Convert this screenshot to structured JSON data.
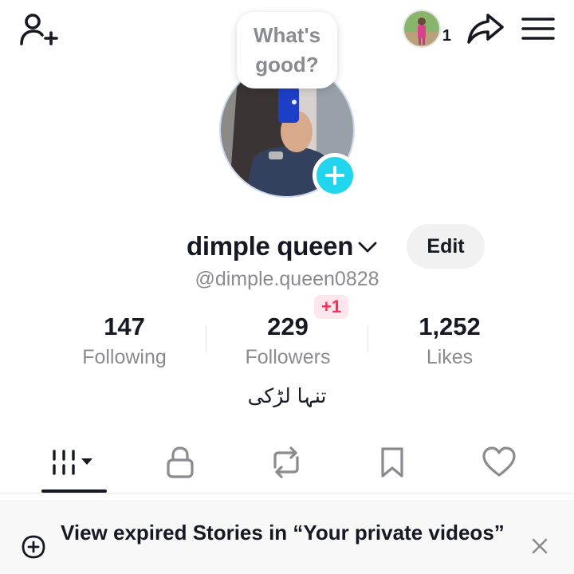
{
  "greeting_bubble": "What's good?",
  "top_bar": {
    "add_friend_icon": "person-add-icon",
    "mini_avatar_count": "1",
    "share_icon": "share-arrow-icon",
    "menu_icon": "hamburger-menu-icon"
  },
  "profile": {
    "display_name": "dimple queen",
    "username": "@dimple.queen0828",
    "edit_label": "Edit",
    "bio": "تنہا لڑکی"
  },
  "stats": [
    {
      "value": "147",
      "label": "Following"
    },
    {
      "value": "229",
      "label": "Followers",
      "badge": "+1"
    },
    {
      "value": "1,252",
      "label": "Likes"
    }
  ],
  "tabs": [
    {
      "icon": "videos-grid-icon",
      "active": true
    },
    {
      "icon": "lock-icon",
      "active": false
    },
    {
      "icon": "repost-icon",
      "active": false
    },
    {
      "icon": "bookmark-icon",
      "active": false
    },
    {
      "icon": "heart-icon",
      "active": false
    }
  ],
  "banner": {
    "text": "View expired Stories in “Your private videos”",
    "icon": "add-story-icon",
    "close_icon": "close-icon"
  },
  "colors": {
    "accent_add": "#20d5ec",
    "badge_text": "#fe2c55",
    "badge_bg": "#fde7ec",
    "secondary_text": "#8a8b91"
  }
}
